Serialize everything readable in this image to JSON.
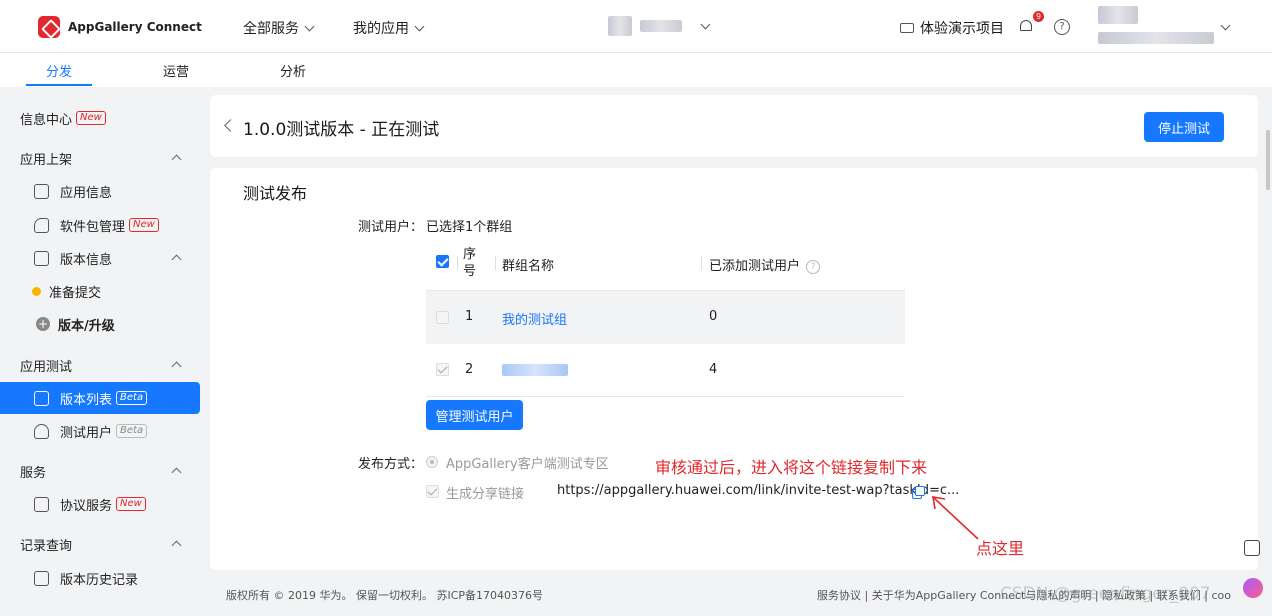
{
  "app": {
    "logo_text": "AppGallery Connect"
  },
  "header": {
    "all_services": "全部服务",
    "my_apps": "我的应用",
    "demo_project": "体验演示项目",
    "notif_count": "9",
    "help": "?"
  },
  "tabs": [
    {
      "label": "分发",
      "active": true
    },
    {
      "label": "运营"
    },
    {
      "label": "分析"
    }
  ],
  "sidebar": {
    "info_center": "信息中心",
    "info_center_tag": "New",
    "app_listing": "应用上架",
    "app_info": "应用信息",
    "package_mgmt": "软件包管理",
    "package_mgmt_tag": "New",
    "version_info": "版本信息",
    "prepare_submit": "准备提交",
    "version_upgrade": "版本/升级",
    "app_test": "应用测试",
    "version_list": "版本列表",
    "version_list_tag": "Beta",
    "test_users": "测试用户",
    "test_users_tag": "Beta",
    "services": "服务",
    "agreement_service": "协议服务",
    "agreement_service_tag": "New",
    "records": "记录查询",
    "version_history": "版本历史记录"
  },
  "page": {
    "title": "1.0.0测试版本 - 正在测试",
    "stop_button": "停止测试",
    "section_title": "测试发布",
    "test_users_label": "测试用户：",
    "selected_groups": "已选择1个群组",
    "table": {
      "headers": {
        "index": "序号",
        "group_name": "群组名称",
        "added_users": "已添加测试用户"
      },
      "rows": [
        {
          "index": "1",
          "group_name": "我的测试组",
          "added_users": "0"
        },
        {
          "index": "2",
          "group_name": "",
          "added_users": "4"
        }
      ]
    },
    "manage_button": "管理测试用户",
    "publish_label": "发布方式：",
    "publish_option": "AppGallery客户端测试专区",
    "share_link_label": "生成分享链接",
    "share_link": "https://appgallery.huawei.com/link/invite-test-wap?taskId=c..."
  },
  "annotations": {
    "note1": "审核通过后，进入将这个链接复制下来",
    "note2": "点这里"
  },
  "footer": {
    "copyright": "版权所有 © 2019 华为。 保留一切权利。 苏ICP备17040376号",
    "links": "服务协议 | 关于华为AppGallery Connect与隐私的声明 | 隐私政策 | 联系我们 | coo",
    "watermark": "CSDN @greenfinger_007"
  },
  "colors": {
    "primary": "#1677ff",
    "brand_red": "#e3282e",
    "status_yellow": "#f7b500"
  }
}
